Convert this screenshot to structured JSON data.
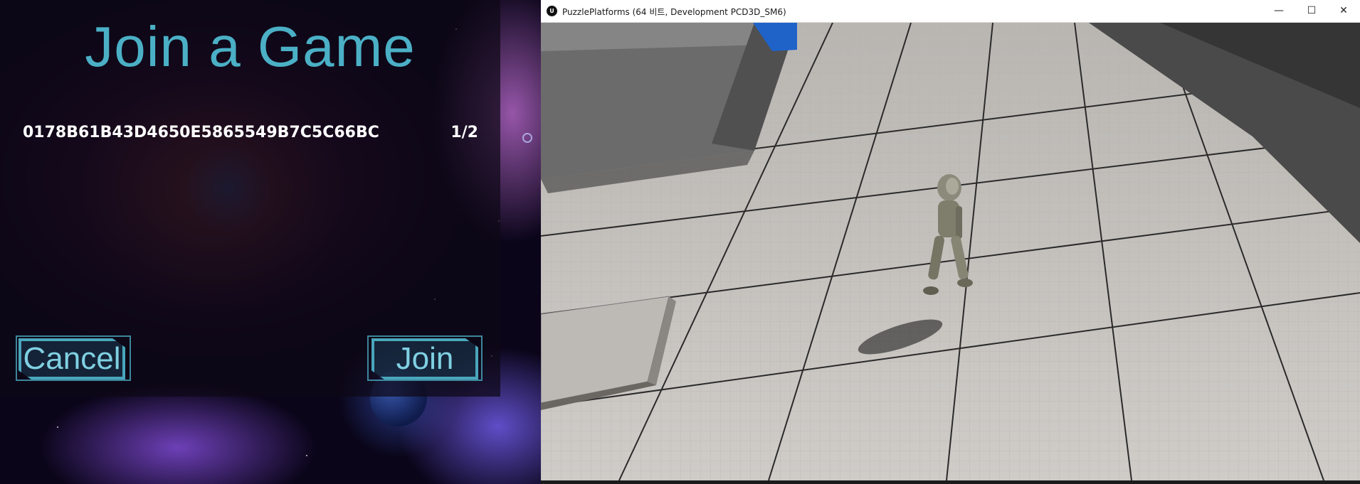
{
  "menu": {
    "title": "Join a Game",
    "server": {
      "name": "0178B61B43D4650E5865549B7C5C66BC",
      "players": "1/2"
    },
    "buttons": {
      "cancel": "Cancel",
      "join": "Join"
    },
    "accent_color": "#4bb0c6"
  },
  "game_window": {
    "title": "PuzzlePlatforms (64 비트, Development PCD3D_SM6)",
    "logo": "U",
    "controls": {
      "minimize": "—",
      "maximize": "☐",
      "close": "✕"
    },
    "icons": [
      "unreal-logo-icon",
      "minimize-icon",
      "maximize-icon",
      "close-icon"
    ]
  }
}
